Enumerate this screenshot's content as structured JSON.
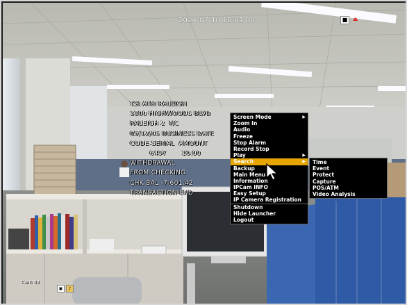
{
  "osd": {
    "timestamp": "2014-07-10 16:01:00",
    "camera_label": "Cam 02"
  },
  "pos_text": [
    "TSI ATM RALEIGH",
    "3100 HIGHWOODS BLVD",
    "RALEIGH 2  NC",
    "05/12/05 BUSINESS DATE",
    "CODE-SERIAL  AMOUNT",
    "         6497       10.00",
    "WITHDRAWAL",
    "FROM CHECKING",
    "CHK BAL -7-601.42",
    "TRANSACTION END"
  ],
  "main_menu": {
    "items": [
      {
        "label": "Screen Mode",
        "has_submenu": true
      },
      {
        "label": "Zoom In",
        "has_submenu": false
      },
      {
        "label": "Audio",
        "has_submenu": false
      },
      {
        "label": "Freeze",
        "has_submenu": false
      },
      {
        "label": "Stop Alarm",
        "has_submenu": false
      },
      {
        "label": "Record Stop",
        "has_submenu": false
      },
      {
        "label": "Play",
        "has_submenu": true
      },
      {
        "label": "Search",
        "has_submenu": true,
        "active": true
      },
      {
        "label": "Backup",
        "has_submenu": false
      },
      {
        "label": "Main Menu",
        "has_submenu": false
      },
      {
        "label": "Information",
        "has_submenu": false
      },
      {
        "label": "IPCam INFO",
        "has_submenu": false
      },
      {
        "label": "Easy Setup",
        "has_submenu": false
      },
      {
        "label": "IP Camera Registration",
        "has_submenu": false
      },
      {
        "label": "Shutdown",
        "has_submenu": false
      },
      {
        "label": "Hide Launcher",
        "has_submenu": false
      },
      {
        "label": "Logout",
        "has_submenu": false
      }
    ]
  },
  "search_submenu": {
    "items": [
      "Time",
      "Event",
      "Protect",
      "Capture",
      "POS/ATM",
      "Video Analysis"
    ]
  },
  "icons": {
    "top": [
      "record-icon",
      "alarm-icon"
    ],
    "bottom": [
      "camera-icon",
      "audio-icon"
    ]
  },
  "colors": {
    "menu_highlight": "#e7a500",
    "menu_bg": "#000000",
    "osd_text": "#ffffff"
  }
}
